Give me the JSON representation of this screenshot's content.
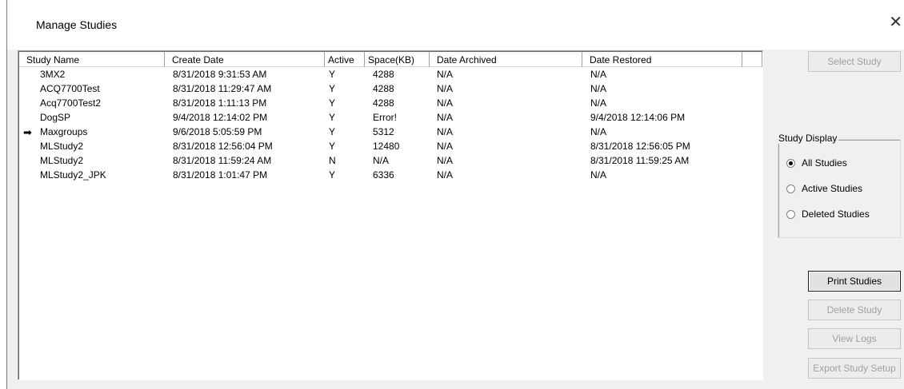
{
  "window": {
    "title": "Manage Studies",
    "close_glyph": "✕"
  },
  "table": {
    "columns": [
      "Study Name",
      "Create Date",
      "Active",
      "Space(KB)",
      "Date Archived",
      "Date Restored"
    ],
    "current_row_indicator": "arrow-right-icon",
    "rows": [
      {
        "name": "3MX2",
        "create": "8/31/2018  9:31:53 AM",
        "active": "Y",
        "space": "4288",
        "archived": "N/A",
        "restored": "N/A",
        "current": false
      },
      {
        "name": "ACQ7700Test",
        "create": "8/31/2018  11:29:47 AM",
        "active": "Y",
        "space": "4288",
        "archived": "N/A",
        "restored": "N/A",
        "current": false
      },
      {
        "name": "Acq7700Test2",
        "create": "8/31/2018  1:11:13 PM",
        "active": "Y",
        "space": "4288",
        "archived": "N/A",
        "restored": "N/A",
        "current": false
      },
      {
        "name": "DogSP",
        "create": "9/4/2018  12:14:02 PM",
        "active": "Y",
        "space": "Error!",
        "archived": "N/A",
        "restored": "9/4/2018  12:14:06 PM",
        "current": false
      },
      {
        "name": "Maxgroups",
        "create": "9/6/2018  5:05:59 PM",
        "active": "Y",
        "space": "5312",
        "archived": "N/A",
        "restored": "N/A",
        "current": true
      },
      {
        "name": "MLStudy2",
        "create": "8/31/2018  12:56:04 PM",
        "active": "Y",
        "space": "12480",
        "archived": "N/A",
        "restored": "8/31/2018  12:56:05 PM",
        "current": false
      },
      {
        "name": "MLStudy2",
        "create": "8/31/2018  11:59:24 AM",
        "active": "N",
        "space": "N/A",
        "archived": "N/A",
        "restored": "8/31/2018  11:59:25 AM",
        "current": false
      },
      {
        "name": "MLStudy2_JPK",
        "create": "8/31/2018  1:01:47 PM",
        "active": "Y",
        "space": "6336",
        "archived": "N/A",
        "restored": "N/A",
        "current": false
      }
    ]
  },
  "buttons": {
    "select_study": "Select Study",
    "print_studies": "Print Studies",
    "delete_study": "Delete Study",
    "view_logs": "View Logs",
    "export_study_setup": "Export Study Setup"
  },
  "study_display": {
    "legend": "Study Display",
    "options": [
      "All Studies",
      "Active Studies",
      "Deleted Studies"
    ],
    "selected": "All Studies"
  }
}
